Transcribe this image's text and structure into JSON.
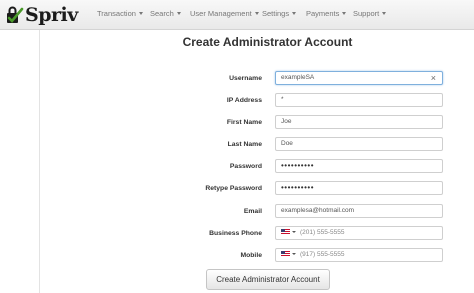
{
  "brand": {
    "logo_icon": "spriv-check-lock-logo-icon",
    "name": "Spriv"
  },
  "nav": [
    {
      "label": "Transaction"
    },
    {
      "label": "Search"
    },
    {
      "label": "User Management"
    },
    {
      "label": "Settings"
    },
    {
      "label": "Payments"
    },
    {
      "label": "Support"
    }
  ],
  "form": {
    "title": "Create Administrator Account",
    "fields": [
      {
        "label": "Username",
        "value": "exampleSA",
        "clear_icon": "×"
      },
      {
        "label": "IP Address",
        "value": "*"
      },
      {
        "label": "First Name",
        "value": "Joe"
      },
      {
        "label": "Last Name",
        "value": "Doe"
      },
      {
        "label": "Password",
        "value": "••••••••••"
      },
      {
        "label": "Retype Password",
        "value": "••••••••••"
      },
      {
        "label": "Email",
        "value": "examplesa@hotmail.com"
      },
      {
        "label": "Business Phone",
        "value": "(201) 555-5555",
        "flag_icon": "us-flag-icon"
      },
      {
        "label": "Mobile",
        "value": "(917) 555-5555",
        "flag_icon": "us-flag-icon"
      }
    ],
    "submit_label": "Create Administrator Account"
  },
  "colors": {
    "navbar": "#f2f2f2",
    "brand_green": "#4a9a2a",
    "focus_border": "#7fb0dd"
  }
}
